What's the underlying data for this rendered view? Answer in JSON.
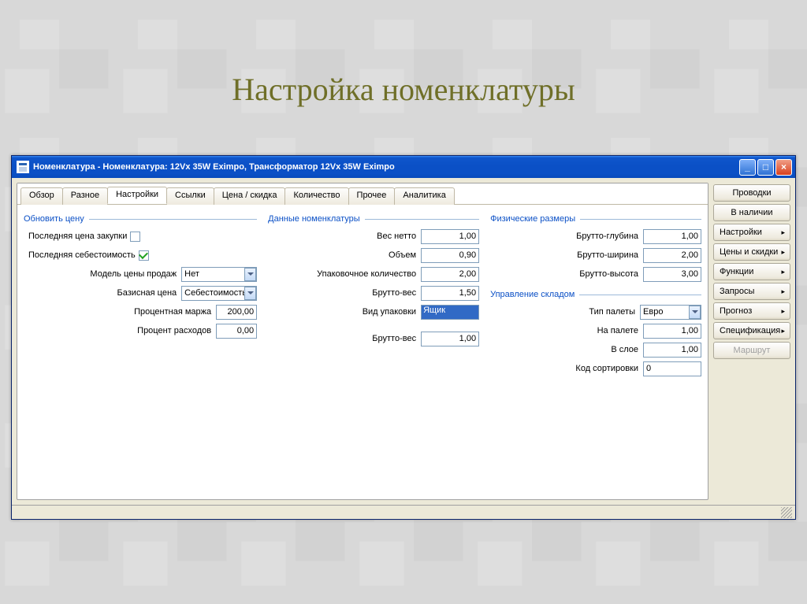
{
  "slide_title": "Настройка номенклатуры",
  "window_title": "Номенклатура - Номенклатура: 12Vx 35W Eximpo, Трансформатор 12Vx 35W Eximpo",
  "tabs": [
    {
      "label": "Обзор"
    },
    {
      "label": "Разное"
    },
    {
      "label": "Настройки"
    },
    {
      "label": "Ссылки"
    },
    {
      "label": "Цена / скидка"
    },
    {
      "label": "Количество"
    },
    {
      "label": "Прочее"
    },
    {
      "label": "Аналитика"
    }
  ],
  "groups": {
    "update_price": {
      "header": "Обновить цену",
      "last_purchase_label": "Последняя цена закупки",
      "last_purchase_checked": false,
      "last_cost_label": "Последняя себестоимость",
      "last_cost_checked": true,
      "sales_model_label": "Модель цены продаж",
      "sales_model_value": "Нет",
      "base_price_label": "Базисная цена",
      "base_price_value": "Себестоимость",
      "percent_margin_label": "Процентная маржа",
      "percent_margin_value": "200,00",
      "percent_costs_label": "Процент расходов",
      "percent_costs_value": "0,00"
    },
    "item_data": {
      "header": "Данные номенклатуры",
      "net_weight_label": "Вес нетто",
      "net_weight_value": "1,00",
      "volume_label": "Объем",
      "volume_value": "0,90",
      "pack_qty_label": "Упаковочное количество",
      "pack_qty_value": "2,00",
      "gross_weight_label": "Брутто-вес",
      "gross_weight_value": "1,50",
      "pack_type_label": "Вид упаковки",
      "pack_type_value": "Ящик",
      "gross_weight2_label": "Брутто-вес",
      "gross_weight2_value": "1,00"
    },
    "physical": {
      "header": "Физические размеры",
      "depth_label": "Брутто-глубина",
      "depth_value": "1,00",
      "width_label": "Брутто-ширина",
      "width_value": "2,00",
      "height_label": "Брутто-высота",
      "height_value": "3,00"
    },
    "warehouse": {
      "header": "Управление складом",
      "pallet_type_label": "Тип палеты",
      "pallet_type_value": "Евро",
      "on_pallet_label": "На палете",
      "on_pallet_value": "1,00",
      "in_layer_label": "В слое",
      "in_layer_value": "1,00",
      "sort_code_label": "Код сортировки",
      "sort_code_value": "0"
    }
  },
  "side_buttons": [
    {
      "label": "Проводки",
      "arrow": false,
      "disabled": false
    },
    {
      "label": "В наличии",
      "arrow": false,
      "disabled": false
    },
    {
      "label": "Настройки",
      "arrow": true,
      "disabled": false
    },
    {
      "label": "Цены и скидки",
      "arrow": true,
      "disabled": false
    },
    {
      "label": "Функции",
      "arrow": true,
      "disabled": false
    },
    {
      "label": "Запросы",
      "arrow": true,
      "disabled": false
    },
    {
      "label": "Прогноз",
      "arrow": true,
      "disabled": false
    },
    {
      "label": "Спецификация",
      "arrow": true,
      "disabled": false
    },
    {
      "label": "Маршрут",
      "arrow": false,
      "disabled": true
    }
  ],
  "win_controls": {
    "min": "_",
    "max": "□",
    "close": "×"
  }
}
